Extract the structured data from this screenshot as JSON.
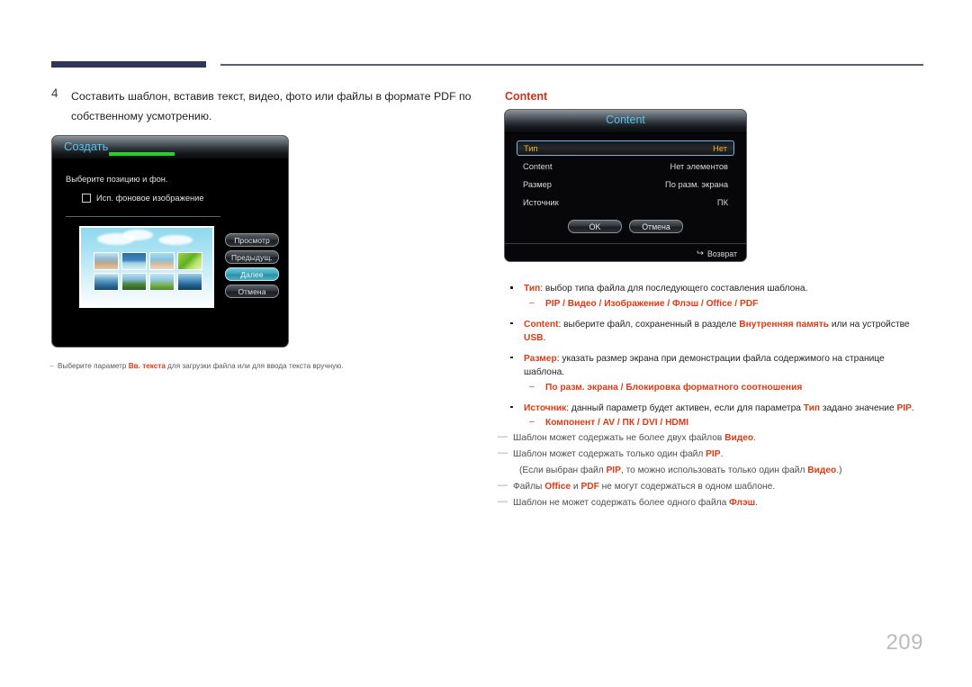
{
  "page": {
    "number": "209"
  },
  "step": {
    "number": "4",
    "text": "Составить шаблон, вставив текст, видео, фото или файлы в формате PDF по собственному усмотрению."
  },
  "create_dialog": {
    "title": "Создать",
    "hint": "Выберите позицию и фон.",
    "checkbox_label": "Исп. фоновое изображение",
    "buttons": [
      {
        "label": "Просмотр",
        "selected": false
      },
      {
        "label": "Предыдущ.",
        "selected": false
      },
      {
        "label": "Далее",
        "selected": true
      },
      {
        "label": "Отмена",
        "selected": false
      }
    ]
  },
  "left_note": {
    "dash": "−",
    "prefix": "Выберите параметр ",
    "highlight": "Вв. текста",
    "suffix": " для загрузки файла или для ввода текста вручную."
  },
  "content_section": {
    "heading": "Content",
    "dialog": {
      "title": "Content",
      "rows": [
        {
          "label": "Тип",
          "value": "Нет",
          "selected": true
        },
        {
          "label": "Content",
          "value": "Нет элементов",
          "selected": false
        },
        {
          "label": "Размер",
          "value": "По разм. экрана",
          "selected": false
        },
        {
          "label": "Источник",
          "value": "ПК",
          "selected": false
        }
      ],
      "ok_label": "OK",
      "cancel_label": "Отмена",
      "return_label": "Возврат",
      "return_icon": "return-arrow-icon"
    }
  },
  "bullets": [
    {
      "term": "Тип",
      "body": ": выбор типа файла для последующего составления шаблона.",
      "sub": "PIP / Видео / Изображение / Флэш / Office / PDF"
    },
    {
      "term": "Content",
      "body_parts": [
        {
          "text": ": выберите файл, сохраненный в разделе ",
          "red": false
        },
        {
          "text": "Внутренняя память",
          "red": true
        },
        {
          "text": " или на устройстве ",
          "red": false
        },
        {
          "text": "USB",
          "red": true
        },
        {
          "text": ".",
          "red": false
        }
      ],
      "sub": null
    },
    {
      "term": "Размер",
      "body": ": указать размер экрана при демонстрации файла содержимого на странице шаблона.",
      "sub": "По разм. экрана / Блокировка форматного соотношения"
    },
    {
      "term": "Источник",
      "body_parts": [
        {
          "text": ": данный параметр будет активен, если для параметра ",
          "red": false
        },
        {
          "text": "Тип",
          "red": true
        },
        {
          "text": " задано значение ",
          "red": false
        },
        {
          "text": "PIP",
          "red": true
        },
        {
          "text": ".",
          "red": false
        }
      ],
      "sub": "Компонент / AV / ПК / DVI / HDMI"
    }
  ],
  "notes": [
    {
      "dash": "—",
      "parts": [
        {
          "text": "Шаблон может содержать не более двух файлов ",
          "red": false
        },
        {
          "text": "Видео",
          "red": true
        },
        {
          "text": ".",
          "red": false
        }
      ],
      "continuation": null
    },
    {
      "dash": "—",
      "parts": [
        {
          "text": "Шаблон может содержать только один файл ",
          "red": false
        },
        {
          "text": "PIP",
          "red": true
        },
        {
          "text": ".",
          "red": false
        }
      ],
      "continuation_parts": [
        {
          "text": "(Если выбран файл ",
          "red": false
        },
        {
          "text": "PIP",
          "red": true
        },
        {
          "text": ", то можно использовать только один файл ",
          "red": false
        },
        {
          "text": "Видео",
          "red": true
        },
        {
          "text": ".)",
          "red": false
        }
      ]
    },
    {
      "dash": "—",
      "parts": [
        {
          "text": "Файлы ",
          "red": false
        },
        {
          "text": "Office",
          "red": true
        },
        {
          "text": " и ",
          "red": false
        },
        {
          "text": "PDF",
          "red": true
        },
        {
          "text": " не могут содержаться в одном шаблоне.",
          "red": false
        }
      ],
      "continuation": null
    },
    {
      "dash": "—",
      "parts": [
        {
          "text": "Шаблон не может содержать более одного файла ",
          "red": false
        },
        {
          "text": "Флэш",
          "red": true
        },
        {
          "text": ".",
          "red": false
        }
      ],
      "continuation": null
    }
  ],
  "colors": {
    "header_bar": "#2e3557",
    "header_line": "#565d7b",
    "heading_red": "#d4311a",
    "accent_red": "#e03a12",
    "dialog_title_cyan": "#56c4f0",
    "selected_row_amber": "#f2b528",
    "progress_green": "#28d02a",
    "selected_button_teal": "#3da5bb",
    "page_number_gray": "#b9bcbe"
  }
}
